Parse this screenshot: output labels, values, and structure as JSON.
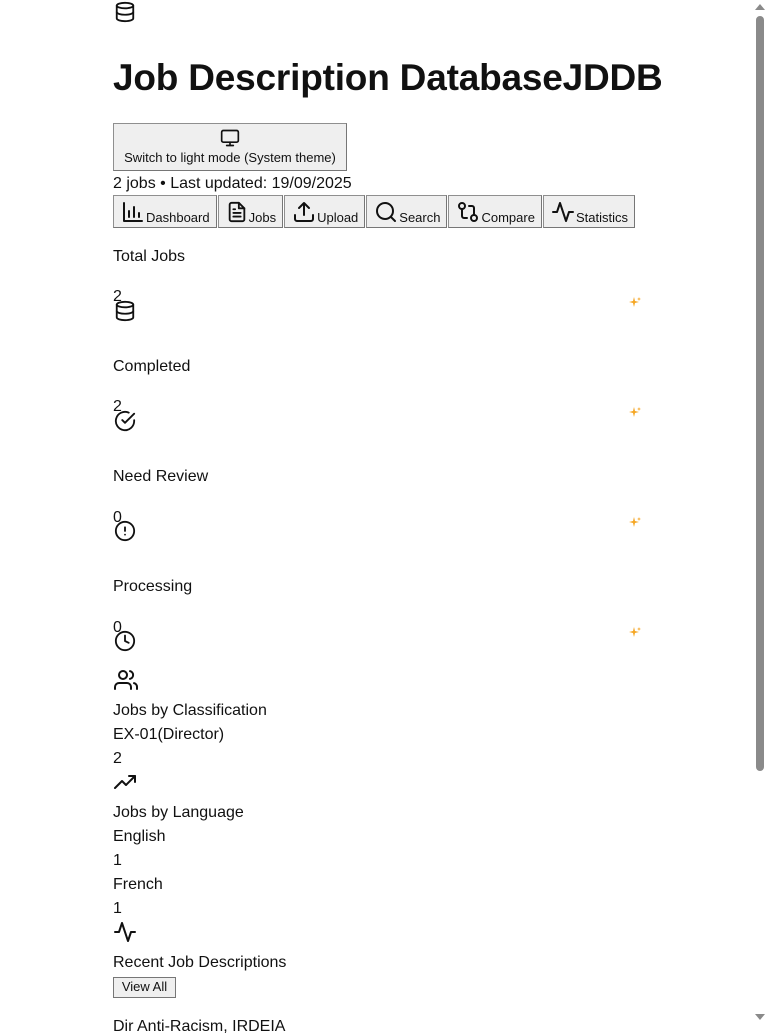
{
  "header": {
    "logo_icon": "database-icon",
    "title": "Job Description DatabaseJDDB",
    "theme_button_label": "Switch to light mode (System theme)",
    "theme_button_icon": "monitor-icon",
    "subtitle": "2 jobs • Last updated: 19/09/2025"
  },
  "nav": {
    "items": [
      {
        "label": "Dashboard",
        "icon": "bar-chart-icon"
      },
      {
        "label": "Jobs",
        "icon": "file-text-icon"
      },
      {
        "label": "Upload",
        "icon": "upload-icon"
      },
      {
        "label": "Search",
        "icon": "search-icon"
      },
      {
        "label": "Compare",
        "icon": "git-compare-icon"
      },
      {
        "label": "Statistics",
        "icon": "activity-icon"
      }
    ]
  },
  "stats": [
    {
      "label": "Total Jobs",
      "value": "2",
      "icon": "database-icon"
    },
    {
      "label": "Completed",
      "value": "2",
      "icon": "check-circle-icon"
    },
    {
      "label": "Need Review",
      "value": "0",
      "icon": "alert-circle-icon"
    },
    {
      "label": "Processing",
      "value": "0",
      "icon": "clock-icon"
    }
  ],
  "classification": {
    "icon": "users-icon",
    "title": "Jobs by Classification",
    "items": [
      {
        "name": "EX-01(Director)",
        "count": "2"
      }
    ]
  },
  "language": {
    "icon": "trending-up-icon",
    "title": "Jobs by Language",
    "items": [
      {
        "name": "English",
        "count": "1"
      },
      {
        "name": "French",
        "count": "1"
      }
    ]
  },
  "recent": {
    "icon": "activity-icon",
    "title": "Recent Job Descriptions",
    "view_all_label": "View All",
    "first_item_partial": "Dir Anti-Racism, IRDEIA"
  },
  "colors": {
    "sparkle": "#f5a623",
    "button_bg": "#efefef",
    "text": "#111111"
  }
}
